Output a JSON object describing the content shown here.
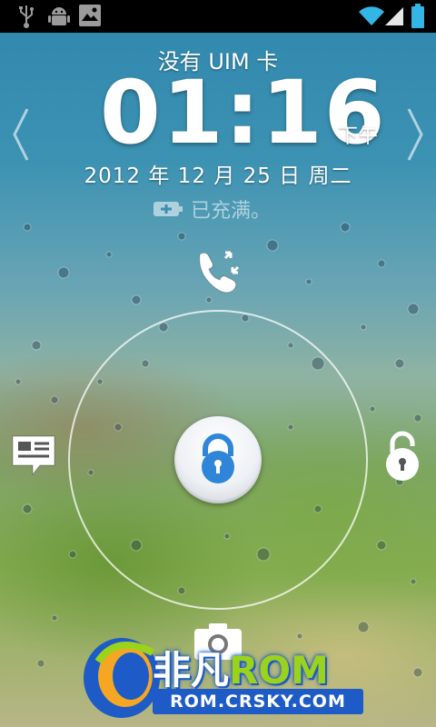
{
  "status_bar": {
    "left_icons": [
      "usb-icon",
      "android-debug-icon",
      "gallery-notification-icon"
    ],
    "right_icons": [
      "wifi-icon",
      "signal-icon",
      "battery-icon"
    ]
  },
  "lockscreen": {
    "carrier": "没有 UIM 卡",
    "time": "01:16",
    "ampm": "下午",
    "date": "2012 年 12 月 25 日 周二",
    "charge_status": "已充满。",
    "targets": [
      "phone-icon",
      "message-icon",
      "unlock-icon",
      "camera-icon"
    ]
  },
  "watermark": {
    "brand_prefix": "非凡",
    "brand_suffix": "ROM",
    "url": "ROM.CRSKY.COM"
  },
  "colors": {
    "status_bar": "#000000",
    "lock_icon": "#2f86d8",
    "watermark_blue": "#1e5bc6",
    "watermark_green": "#9bd31c"
  }
}
